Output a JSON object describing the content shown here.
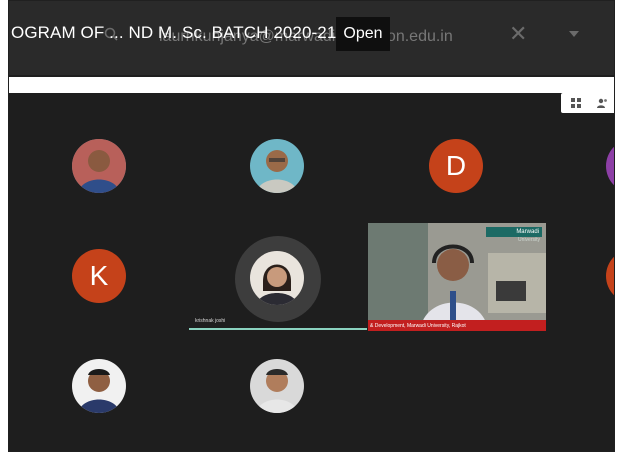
{
  "meeting": {
    "title": "OGRAM OF ... ND M. Sc. BATCH 2020-21",
    "email": "laurnkunjanya@marwadieducation.edu.in",
    "open_label": "Open",
    "close_glyph": "✕"
  },
  "participants": [
    {
      "letter": "D",
      "color": "#c5421a"
    },
    {
      "letter": "K",
      "color": "#c5421a"
    }
  ],
  "speaker": {
    "name": "krishnak joshi"
  },
  "video": {
    "logo": "Marwadi",
    "logo_sub": "University",
    "caption": "& Development, Marwadi University, Rajkot"
  },
  "colors": {
    "meet_bg": "#1e1e1e",
    "accent_speaking": "#8bd3c0",
    "avatar_letter_bg": "#c5421a"
  }
}
